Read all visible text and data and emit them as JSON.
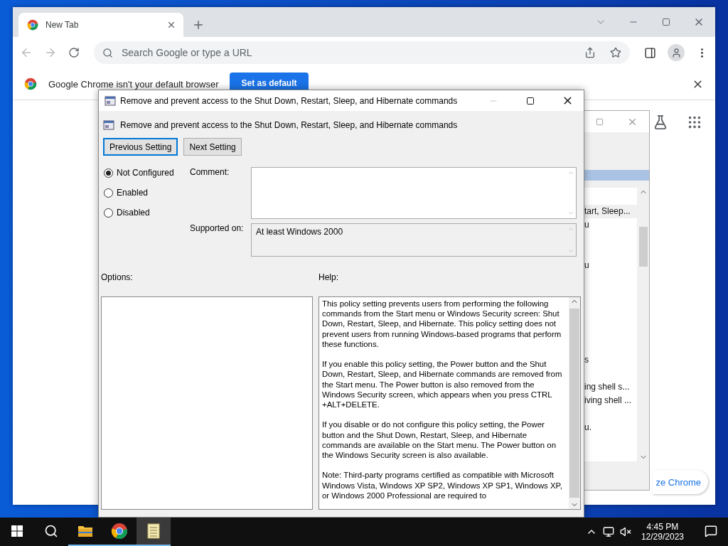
{
  "chrome": {
    "tab": {
      "title": "New Tab"
    },
    "omnibox": {
      "placeholder": "Search Google or type a URL"
    },
    "infobar": {
      "message": "Google Chrome isn't your default browser",
      "button": "Set as default"
    },
    "customize_button": "ze Chrome"
  },
  "background_window": {
    "rows": [
      {
        "text": "tart, Sleep...",
        "selected": true
      },
      {
        "text": "u",
        "selected": false
      },
      {
        "text": "u",
        "selected": false
      },
      {
        "text": "s",
        "selected": false
      },
      {
        "text": "ing shell s...",
        "selected": false
      },
      {
        "text": "iving shell ...",
        "selected": false
      },
      {
        "text": "u.",
        "selected": false
      }
    ]
  },
  "dialog": {
    "title": "Remove and prevent access to the Shut Down, Restart, Sleep, and Hibernate commands",
    "heading": "Remove and prevent access to the Shut Down, Restart, Sleep, and Hibernate commands",
    "nav_buttons": [
      {
        "label": "Previous Setting",
        "focused": true
      },
      {
        "label": "Next Setting",
        "focused": false
      }
    ],
    "states": [
      {
        "label": "Not Configured",
        "selected": true
      },
      {
        "label": "Enabled",
        "selected": false
      },
      {
        "label": "Disabled",
        "selected": false
      }
    ],
    "comment": {
      "label": "Comment:"
    },
    "supported_on": {
      "label": "Supported on:",
      "value": "At least Windows 2000"
    },
    "options_label": "Options:",
    "help_label": "Help:",
    "help_paragraphs": [
      "This policy setting prevents users from performing the following commands from the Start menu or Windows Security screen: Shut Down, Restart, Sleep, and Hibernate. This policy setting does not prevent users from running Windows-based programs that perform these functions.",
      "If you enable this policy setting, the Power button and the Shut Down, Restart, Sleep, and Hibernate commands are removed from the Start menu. The Power button is also removed from the Windows Security screen, which appears when you press CTRL +ALT+DELETE.",
      "If you disable or do not configure this policy setting, the Power button and the Shut Down, Restart, Sleep, and Hibernate commands are available on the Start menu. The Power button on the Windows Security screen is also available.",
      "Note: Third-party programs certified as compatible with Microsoft Windows Vista, Windows XP SP2, Windows XP SP1, Windows XP, or Windows 2000 Professional are required to"
    ]
  },
  "taskbar": {
    "apps": [
      {
        "kind": "explorer",
        "running": true,
        "selected": false
      },
      {
        "kind": "chrome",
        "running": true,
        "selected": false
      },
      {
        "kind": "notepad",
        "running": true,
        "selected": true
      }
    ],
    "clock": {
      "time": "4:45 PM",
      "date": "12/29/2023"
    }
  }
}
